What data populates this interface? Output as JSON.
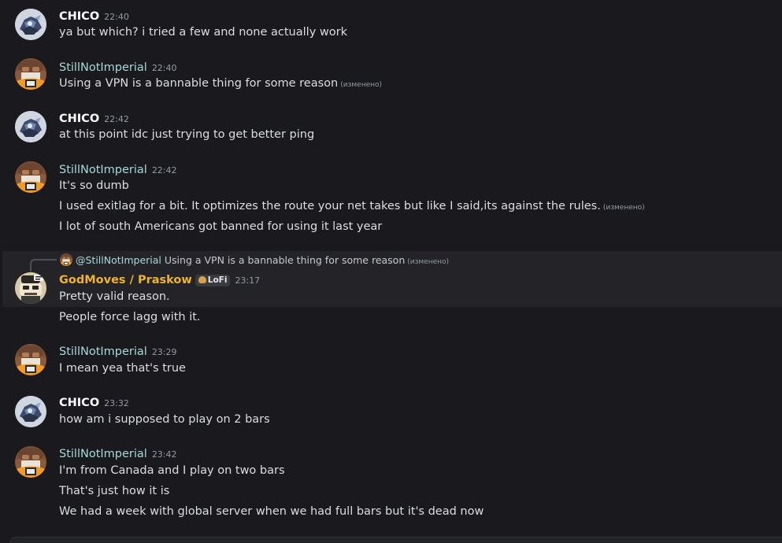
{
  "messages": [
    {
      "author": "CHICO",
      "time": "22:40",
      "lines": [
        {
          "text": "ya but which? i tried a few and none actually work",
          "edited": ""
        }
      ]
    },
    {
      "author": "StillNotImperial",
      "time": "22:40",
      "lines": [
        {
          "text": "Using a VPN is a bannable thing for some reason",
          "edited": "(изменено)"
        }
      ]
    },
    {
      "author": "CHICO",
      "time": "22:42",
      "lines": [
        {
          "text": "at this point idc just trying to get better ping",
          "edited": ""
        }
      ]
    },
    {
      "author": "StillNotImperial",
      "time": "22:42",
      "lines": [
        {
          "text": "It's so dumb",
          "edited": ""
        },
        {
          "text": "I used exitlag for a bit. It optimizes the route your net takes but like I said,its against the rules.",
          "edited": "(изменено)"
        },
        {
          "text": "I lot of south Americans got banned for using it last year",
          "edited": ""
        }
      ]
    },
    {
      "author": "GodMoves / Praskow",
      "tag": "LoFi",
      "time": "23:17",
      "reply": {
        "author": "@StillNotImperial",
        "text": "Using a VPN is a bannable thing for some reason",
        "edited": "(изменено)"
      },
      "lines": [
        {
          "text": "Pretty valid reason.",
          "edited": ""
        },
        {
          "text": "People force lagg with it.",
          "edited": ""
        }
      ]
    },
    {
      "author": "StillNotImperial",
      "time": "23:29",
      "lines": [
        {
          "text": "I mean yea that's true",
          "edited": ""
        }
      ]
    },
    {
      "author": "CHICO",
      "time": "23:32",
      "lines": [
        {
          "text": "how am i supposed to play on 2 bars",
          "edited": ""
        }
      ]
    },
    {
      "author": "StillNotImperial",
      "time": "23:42",
      "lines": [
        {
          "text": "I'm from Canada and I play on two bars",
          "edited": ""
        },
        {
          "text": "That's just how it is",
          "edited": ""
        },
        {
          "text": "We had a week with global server when we had full bars but it's dead now",
          "edited": ""
        }
      ]
    }
  ],
  "colors": {
    "background": "#1a1a1e",
    "highlight": "#242428",
    "chico_name": "#ffffff",
    "still_name": "#a6d9da",
    "god_name": "#f0b232",
    "timestamp": "#949ba4",
    "text": "#dbdee1"
  },
  "icons": {
    "chico_avatar": "armored-figure-avatar",
    "still_avatar": "aviator-cap-avatar",
    "god_avatar": "cartoon-face-avatar",
    "tag_icon": "bread-icon"
  }
}
